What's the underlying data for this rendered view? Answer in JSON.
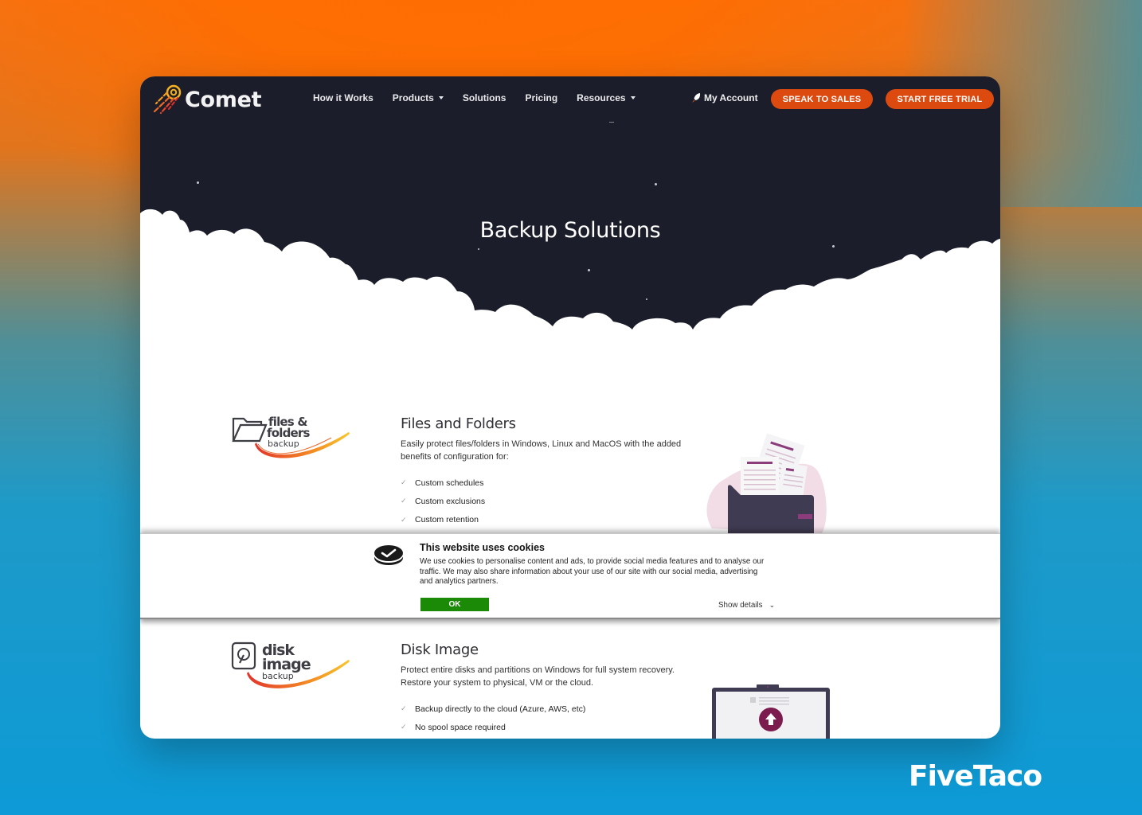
{
  "nav": {
    "logo_text": "Comet",
    "links": [
      {
        "label": "How it Works",
        "dropdown": false
      },
      {
        "label": "Products",
        "dropdown": true
      },
      {
        "label": "Solutions",
        "dropdown": false
      },
      {
        "label": "Pricing",
        "dropdown": false
      },
      {
        "label": "Resources",
        "dropdown": true
      }
    ],
    "account_label": "My Account",
    "account_icon": "rocket-icon",
    "speak_to_sales": "SPEAK TO SALES",
    "start_free_trial": "START FREE TRIAL"
  },
  "hero": {
    "title": "Backup Solutions"
  },
  "sections": [
    {
      "logo": {
        "line1": "files &",
        "line2": "folders",
        "line3": "backup"
      },
      "title": "Files and Folders",
      "description": "Easily protect files/folders in Windows, Linux and MacOS with the added benefits of configuration for:",
      "features": [
        "Custom schedules",
        "Custom exclusions",
        "Custom retention"
      ],
      "illustration": "folder-with-documents"
    },
    {
      "logo": {
        "line1": "disk",
        "line2": "image",
        "line3": "backup"
      },
      "title": "Disk Image",
      "description": "Protect entire disks and partitions on Windows for full system recovery. Restore your system to physical, VM or the cloud.",
      "features": [
        "Backup directly to the cloud (Azure, AWS, etc)",
        "No spool space required"
      ],
      "illustration": "laptop-upload"
    }
  ],
  "cookie_banner": {
    "title": "This website uses cookies",
    "text": "We use cookies to personalise content and ads, to provide social media features and to analyse our traffic. We may also share information about your use of our site with our social media, advertising and analytics partners.",
    "ok_label": "OK",
    "details_label": "Show details",
    "ok_color": "#1a8a07"
  },
  "colors": {
    "brand_orange": "#dc4a10",
    "hero_bg": "#1b1e2a",
    "accent_purple": "#7b1b4e"
  },
  "watermark": "FiveTaco"
}
